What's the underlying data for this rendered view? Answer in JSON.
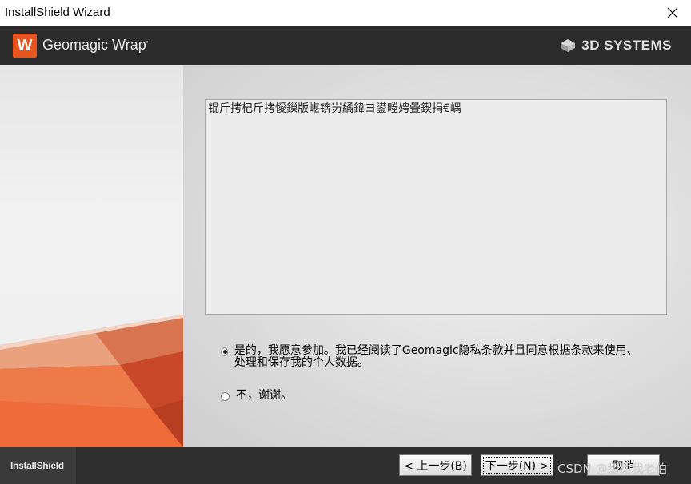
{
  "window": {
    "title": "InstallShield Wizard",
    "close_glyph": "✕"
  },
  "banner": {
    "logo_letter": "W",
    "product": "Geomagic Wrap",
    "product_mark": "•",
    "brand": "3D SYSTEMS"
  },
  "license_text": "锟斤拷杞斤拷懓鏁版嵁锛岃繘鍏ヨ鍙畻娉曡鍥捐€嵎",
  "options": [
    {
      "label": "是的，我愿意参加。我已经阅读了Geomagic隐私条款并且同意根据条款来使用、处理和保存我的个人数据。",
      "selected": true
    },
    {
      "label": "不，谢谢。",
      "selected": false
    }
  ],
  "footer": {
    "installshield": "InstallShield",
    "back": "< 上一步(B)",
    "next": "下一步(N) >",
    "cancel": "取消"
  },
  "watermark": "CSDN @甜甜我老伯",
  "colors": {
    "accent": "#e8541e",
    "banner_bg": "#2b2b2b"
  }
}
